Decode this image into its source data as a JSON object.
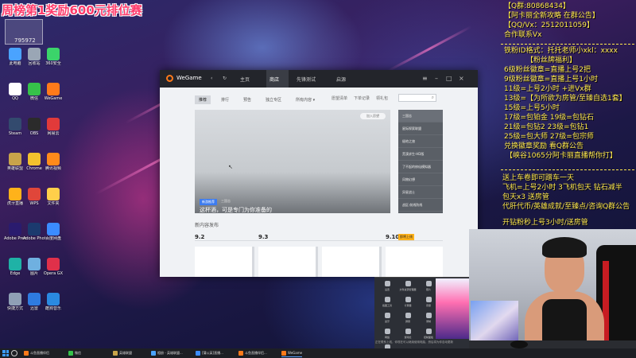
{
  "stream": {
    "title": "周榜第1奖励600元排位赛",
    "room_id": "795972"
  },
  "overlay": {
    "lines": [
      "【Q群:80868434】",
      "【阿卡丽全新攻略 在群公告】",
      "【QQ/Vx：2512011059】",
      "合作联系Vx",
      "铁粉ID格式：托托老师小xkl：xxxx",
      "【粉丝牌福利】",
      "6级粉丝徽章=直播上号2把",
      "9级粉丝徽章=直播上号1小时",
      "11级=上号2小时 +进Vx群",
      "13级=【为所欲为房管/至臻自选1套】",
      "15级=上号5小时",
      "17级=包铂金  19级=包钻石",
      "21级=包钻2   23级=包钻1",
      "25级=包大师  27级=包宗师",
      "兑换徽章奖励 看Q群公告",
      "【峡谷1065分阿卡丽直播帮你打】",
      "送上车卷即可蹭车一天",
      "飞机=上号2小时 3飞机包天 钻石减半",
      "包天x3 送房管",
      "代肝代币/英雄成就/至臻点/咨询Q群公告",
      "开钻粉秒上号3小时/送房管"
    ]
  },
  "desktop": {
    "icons": [
      {
        "label": "此电脑",
        "color": "#4aa3ff"
      },
      {
        "label": "回收站",
        "color": "#9aa6b5"
      },
      {
        "label": "360安全",
        "color": "#3bd46a"
      },
      {
        "label": "QQ",
        "color": "#ffffff"
      },
      {
        "label": "微信",
        "color": "#36c24a"
      },
      {
        "label": "WeGame",
        "color": "#ff7a1a"
      },
      {
        "label": "Steam",
        "color": "#334a6e"
      },
      {
        "label": "OBS",
        "color": "#2b2b2b"
      },
      {
        "label": "网易云",
        "color": "#e13a3a"
      },
      {
        "label": "英雄联盟",
        "color": "#c9a44a"
      },
      {
        "label": "Chrome",
        "color": "#f2c12e"
      },
      {
        "label": "腾讯视频",
        "color": "#ff8a1a"
      },
      {
        "label": "虎牙直播",
        "color": "#ffb21a"
      },
      {
        "label": "WPS",
        "color": "#e0463a"
      },
      {
        "label": "文件夹",
        "color": "#ffcf4a"
      },
      {
        "label": "Adobe Premiere",
        "color": "#2a1b6e"
      },
      {
        "label": "Adobe Photoshop",
        "color": "#1b3a6e"
      },
      {
        "label": "百度网盘",
        "color": "#3b8cff"
      },
      {
        "label": "Edge",
        "color": "#1fb2a6"
      },
      {
        "label": "图片",
        "color": "#6fb0e0"
      },
      {
        "label": "Opera GX",
        "color": "#e0304a"
      },
      {
        "label": "快捷方式",
        "color": "#8fa0b5"
      },
      {
        "label": "迅雷",
        "color": "#2e7be0"
      },
      {
        "label": "酷狗音乐",
        "color": "#2a8ae0"
      }
    ]
  },
  "wegame": {
    "app_name": "WeGame",
    "nav": [
      "主页",
      "商店",
      "先锋测试",
      "启源"
    ],
    "tabs": [
      "推荐",
      "排行",
      "预告",
      "独立专区",
      "所有内容 ▾"
    ],
    "tools": [
      "愿望清单",
      "下单记录",
      "领礼包"
    ],
    "banner": {
      "tag": "新游推荐",
      "subtitle": "三国志",
      "title": "这杯酒，可是专门为你准备的",
      "button": "加入愿望"
    },
    "side_list": [
      "三国志",
      "星际探索联盟",
      "极地之旅",
      "荒漠求生·HD版",
      "了不起的修仙模拟器",
      "风物幻想",
      "异星战士",
      "战区·前线防线"
    ],
    "section_title": "新内容发布",
    "dates": [
      "9.2",
      "9.3",
      "9.10"
    ],
    "date_badge": "即将上线"
  },
  "panel": {
    "actions": [
      "设置",
      "文件资源管理器",
      "照片",
      "截图工具",
      "计算器",
      "音量",
      "蓝牙",
      "屏幕",
      "录制",
      "网络",
      "游戏栏",
      "控制面板",
      "电源"
    ],
    "footer": "正在联系上线，你现在可以继续使用电脑，然后将为你自动更新"
  },
  "taskbar": {
    "items": [
      {
        "label": "斗鱼直播伴侣",
        "color": "#ff7a1a"
      },
      {
        "label": "微信",
        "color": "#36c24a"
      },
      {
        "label": "英雄联盟",
        "color": "#c9a44a"
      },
      {
        "label": "相册 - 英雄联盟...",
        "color": "#4aa3ff"
      },
      {
        "label": "[蒲公英]直播...",
        "color": "#3b8cff"
      },
      {
        "label": "斗鱼直播伴侣...",
        "color": "#ff7a1a"
      },
      {
        "label": "WeGame",
        "color": "#ff7a1a"
      }
    ]
  }
}
